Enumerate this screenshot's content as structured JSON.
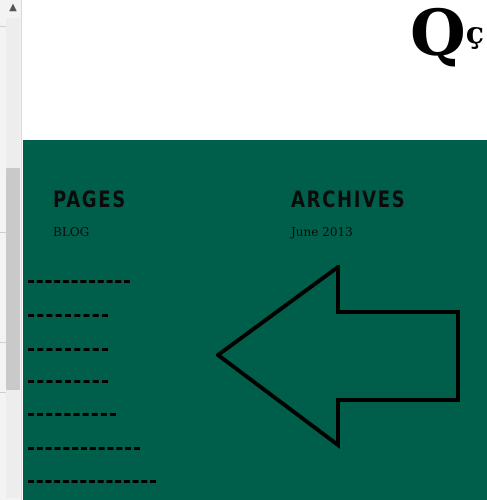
{
  "logo": {
    "mark": "Q",
    "text": "ç"
  },
  "footer": {
    "pages_widget": {
      "title": "PAGES",
      "links": [
        "BLOG"
      ]
    },
    "archives_widget": {
      "title": "ARCHIVES",
      "links": [
        "June 2013"
      ]
    }
  },
  "colors": {
    "footer_bg": "#005f4b",
    "text": "#0b0b0b"
  },
  "icons": {
    "annotation_arrow": "left-arrow-icon",
    "scroll_up": "scroll-up-arrow-icon"
  }
}
